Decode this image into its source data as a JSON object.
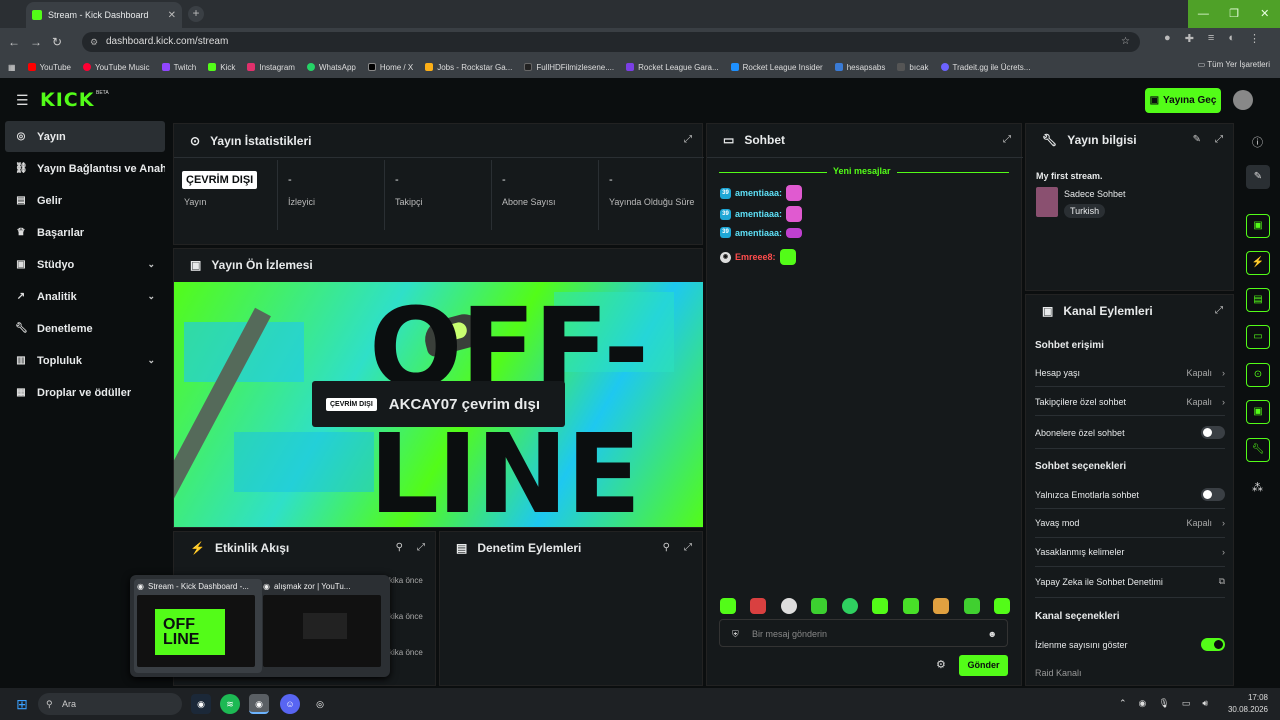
{
  "browser": {
    "tab_title": "Stream - Kick Dashboard",
    "url": "dashboard.kick.com/stream",
    "bookmarks": [
      "YouTube",
      "YouTube Music",
      "Twitch",
      "Kick",
      "Instagram",
      "WhatsApp",
      "Home / X",
      "Jobs - Rockstar Ga...",
      "FullHDFilmizlesene....",
      "Rocket League Gara...",
      "Rocket League Insider",
      "hesapsabs",
      "bıcak",
      "Tradeit.gg ile Ücrets..."
    ],
    "all_bookmarks": "Tüm Yer İşaretleri"
  },
  "header": {
    "logo": "KICK",
    "beta": "BETA",
    "go_live": "Yayına Geç"
  },
  "sidebar": {
    "items": [
      {
        "label": "Yayın"
      },
      {
        "label": "Yayın Bağlantısı ve Anahtarı"
      },
      {
        "label": "Gelir"
      },
      {
        "label": "Başarılar"
      },
      {
        "label": "Stüdyo"
      },
      {
        "label": "Analitik"
      },
      {
        "label": "Denetleme"
      },
      {
        "label": "Topluluk"
      },
      {
        "label": "Droplar ve ödüller"
      }
    ]
  },
  "stats": {
    "title": "Yayın İstatistikleri",
    "offline_badge": "ÇEVRİM DIŞI",
    "items": [
      {
        "value": "",
        "label": "Yayın"
      },
      {
        "value": "-",
        "label": "İzleyici"
      },
      {
        "value": "-",
        "label": "Takipçi"
      },
      {
        "value": "-",
        "label": "Abone Sayısı"
      },
      {
        "value": "-",
        "label": "Yayında Olduğu Süre"
      }
    ]
  },
  "preview": {
    "title": "Yayın Ön İzlemesi",
    "badge": "ÇEVRİM DIŞI",
    "banner_text": "AKCAY07 çevrim dışı",
    "art_text_1": "OFF-",
    "art_text_2": "LINE"
  },
  "activity": {
    "title": "Etkinlik Akışı",
    "times": [
      "kika önce",
      "kika önce",
      "kika önce"
    ]
  },
  "moderation": {
    "title": "Denetim Eylemleri"
  },
  "chat": {
    "title": "Sohbet",
    "new_messages": "Yeni mesajlar",
    "messages": [
      {
        "user": "amentiaaa:",
        "color": "#5ee0f7"
      },
      {
        "user": "amentiaaa:",
        "color": "#5ee0f7"
      },
      {
        "user": "amentiaaa:",
        "color": "#5ee0f7"
      },
      {
        "user": "Emreee8:",
        "color": "#ff4d4d"
      }
    ],
    "placeholder": "Bir mesaj gönderin",
    "send": "Gönder"
  },
  "stream_info": {
    "title": "Yayın bilgisi",
    "stream_title": "My first stream.",
    "category": "Sadece Sohbet",
    "language": "Turkish"
  },
  "channel_actions": {
    "title": "Kanal Eylemleri",
    "chat_access": "Sohbet erişimi",
    "account_age": "Hesap yaşı",
    "account_age_val": "Kapalı",
    "followers_only": "Takipçilere özel sohbet",
    "followers_only_val": "Kapalı",
    "subs_only": "Abonelere özel sohbet",
    "chat_options": "Sohbet seçenekleri",
    "emote_only": "Yalnızca Emotlarla sohbet",
    "slow_mode": "Yavaş mod",
    "slow_mode_val": "Kapalı",
    "banned_words": "Yasaklanmış kelimeler",
    "ai_moderation": "Yapay Zeka ile Sohbet Denetimi",
    "channel_options": "Kanal seçenekleri",
    "show_viewers": "İzlenme sayısını göster",
    "raid_channel": "Raid Kanalı"
  },
  "taskbar": {
    "search": "Ara",
    "time": "17:08",
    "date": "30.08.2026"
  },
  "thumbnails": [
    {
      "title": "Stream - Kick Dashboard -..."
    },
    {
      "title": "alışmak zor | YouTu..."
    }
  ],
  "colors": {
    "accent": "#53fc18",
    "bg": "#0b0e0f",
    "panel": "#15191b"
  }
}
